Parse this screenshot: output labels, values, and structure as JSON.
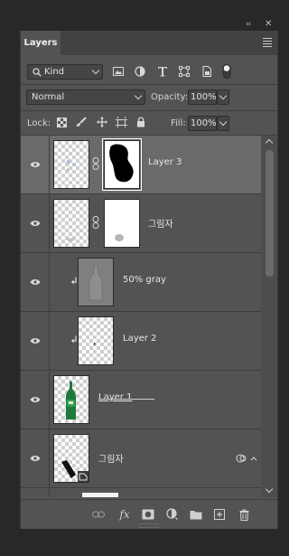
{
  "panel": {
    "tab": "Layers"
  },
  "filter": {
    "kind_label": "Kind"
  },
  "blend": {
    "mode": "Normal",
    "opacity_label": "Opacity:",
    "opacity_value": "100%"
  },
  "lock": {
    "label": "Lock:",
    "fill_label": "Fill:",
    "fill_value": "100%"
  },
  "layers": [
    {
      "name": "Layer 3",
      "selected": true
    },
    {
      "name": "그림자"
    },
    {
      "name": "50%  gray"
    },
    {
      "name": "Layer 2"
    },
    {
      "name": "Layer 1"
    },
    {
      "name": "그림자"
    }
  ],
  "colors": {
    "panel": "#535353",
    "selected_row": "#6a6a6a",
    "background": "#282828"
  },
  "icons": [
    "search-icon",
    "image-filter-icon",
    "adjustment-filter-icon",
    "type-filter-icon",
    "shape-filter-icon",
    "smart-object-filter-icon",
    "filter-toggle-icon",
    "lock-transparent-icon",
    "lock-paint-icon",
    "lock-position-icon",
    "lock-artboard-icon",
    "lock-all-icon",
    "eye-icon",
    "link-chain-icon",
    "clip-arrow-icon",
    "link-layers-icon",
    "fx-icon",
    "add-mask-icon",
    "adjustment-layer-icon",
    "new-group-icon",
    "new-layer-icon",
    "trash-icon"
  ]
}
